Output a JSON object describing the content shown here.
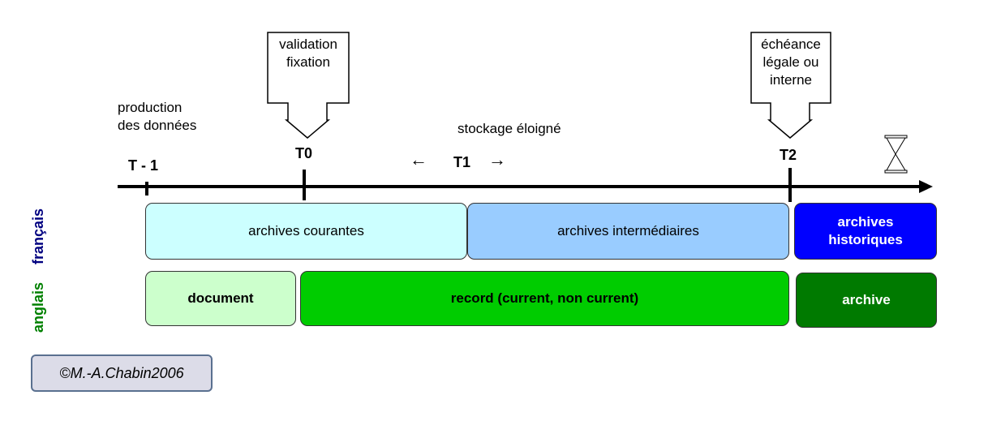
{
  "callouts": [
    {
      "text_lines": [
        "validation",
        "fixation"
      ]
    },
    {
      "text_lines": [
        "échéance",
        "légale ou",
        "interne"
      ]
    }
  ],
  "annotations": {
    "production": [
      "production",
      "des données"
    ],
    "stockage": "stockage éloigné",
    "t1_arrows_left": "←",
    "t1_arrows_right": "→"
  },
  "timeline": {
    "labels": [
      "T - 1",
      "T0",
      "T1",
      "T2"
    ],
    "end_icon": "hourglass-icon"
  },
  "rows": {
    "francais": {
      "label": "français",
      "color": "#000080",
      "boxes": [
        {
          "text": "archives courantes",
          "fill": "#ccffff"
        },
        {
          "text": "archives intermédiaires",
          "fill": "#99ccff"
        },
        {
          "text": "archives historiques",
          "fill": "#0000ff"
        }
      ]
    },
    "anglais": {
      "label": "anglais",
      "color": "#008000",
      "boxes": [
        {
          "text": "document",
          "fill": "#ccffcc"
        },
        {
          "text": "record (current, non current)",
          "fill": "#00cc00"
        },
        {
          "text": "archive",
          "fill": "#007a00"
        }
      ]
    }
  },
  "copyright": "©M.-A.Chabin2006"
}
